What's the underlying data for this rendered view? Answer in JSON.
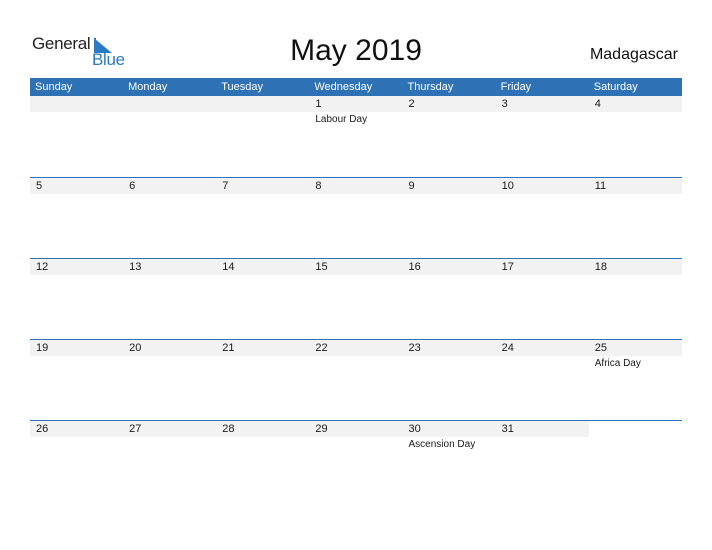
{
  "logo": {
    "word1": "General",
    "word2": "Blue",
    "icon": "triangle-flag-icon"
  },
  "title": "May 2019",
  "country": "Madagascar",
  "colors": {
    "header_bg": "#2e72b5",
    "band_bg": "#f2f2f2",
    "logo_blue": "#2a7bc4"
  },
  "weekdays": [
    "Sunday",
    "Monday",
    "Tuesday",
    "Wednesday",
    "Thursday",
    "Friday",
    "Saturday"
  ],
  "weeks": [
    [
      {
        "day": ""
      },
      {
        "day": ""
      },
      {
        "day": ""
      },
      {
        "day": "1",
        "holiday": "Labour Day"
      },
      {
        "day": "2"
      },
      {
        "day": "3"
      },
      {
        "day": "4"
      }
    ],
    [
      {
        "day": "5"
      },
      {
        "day": "6"
      },
      {
        "day": "7"
      },
      {
        "day": "8"
      },
      {
        "day": "9"
      },
      {
        "day": "10"
      },
      {
        "day": "11"
      }
    ],
    [
      {
        "day": "12"
      },
      {
        "day": "13"
      },
      {
        "day": "14"
      },
      {
        "day": "15"
      },
      {
        "day": "16"
      },
      {
        "day": "17"
      },
      {
        "day": "18"
      }
    ],
    [
      {
        "day": "19"
      },
      {
        "day": "20"
      },
      {
        "day": "21"
      },
      {
        "day": "22"
      },
      {
        "day": "23"
      },
      {
        "day": "24"
      },
      {
        "day": "25",
        "holiday": "Africa Day"
      }
    ],
    [
      {
        "day": "26"
      },
      {
        "day": "27"
      },
      {
        "day": "28"
      },
      {
        "day": "29"
      },
      {
        "day": "30",
        "holiday": "Ascension Day"
      },
      {
        "day": "31"
      },
      {
        "day": ""
      }
    ]
  ]
}
